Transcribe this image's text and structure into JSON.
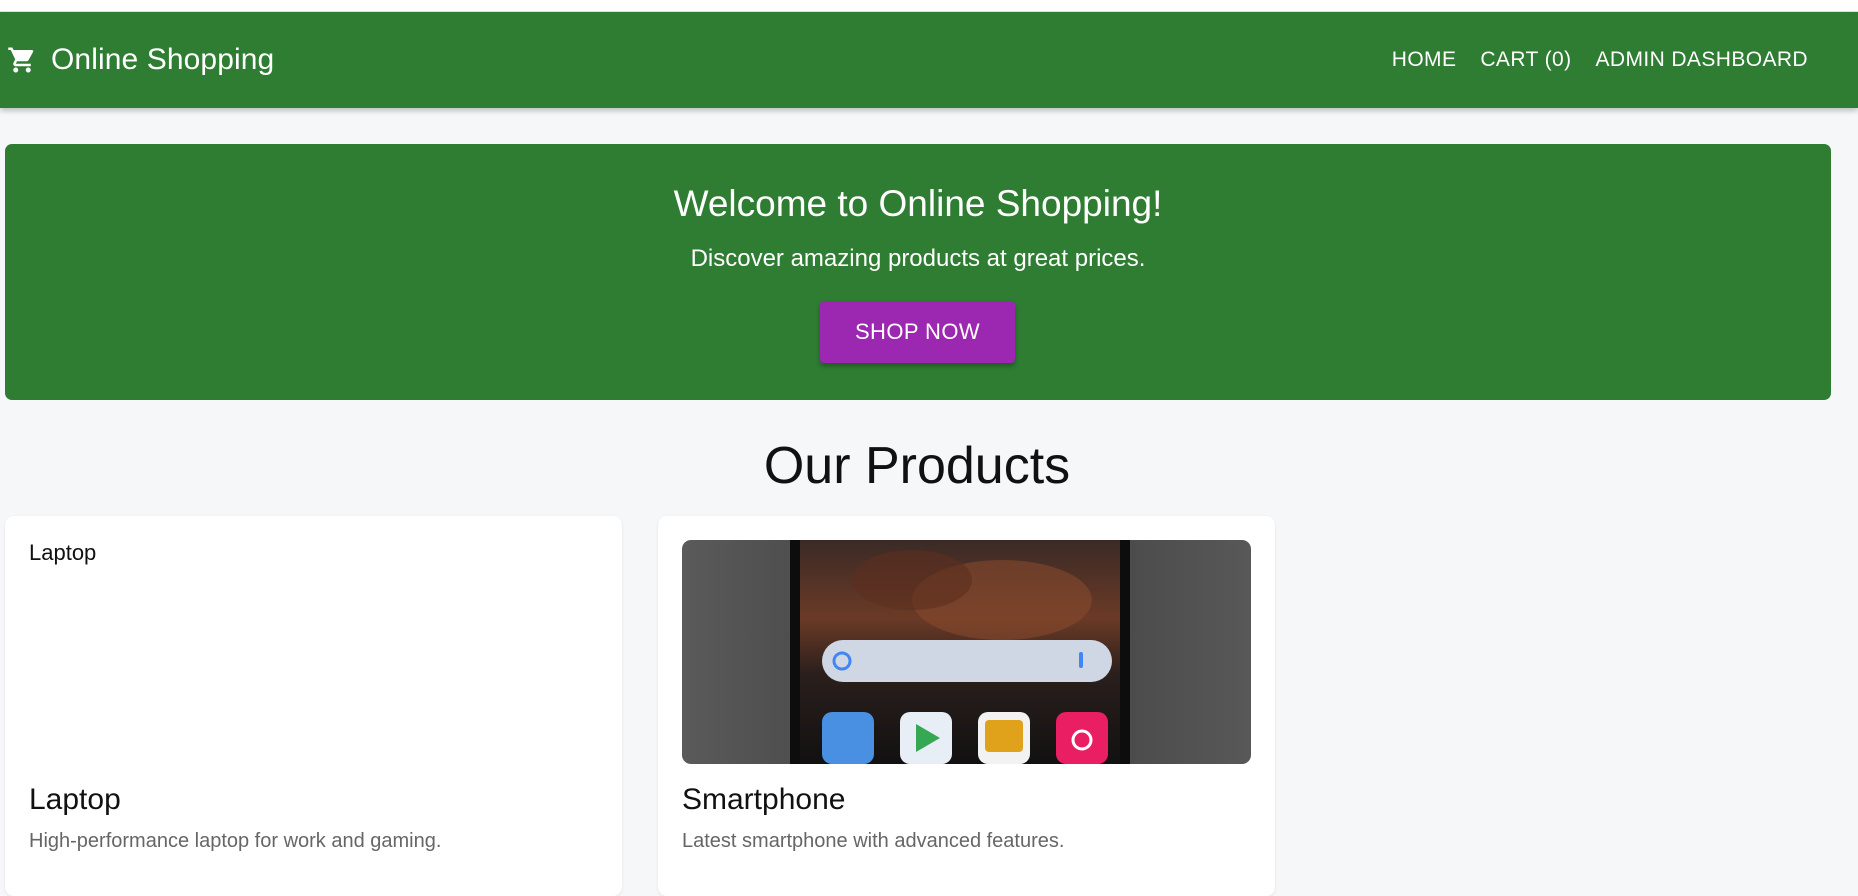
{
  "app_bar": {
    "brand_icon": "shopping-cart-icon",
    "title": "Online Shopping",
    "nav": [
      "HOME",
      "CART (0)",
      "ADMIN DASHBOARD"
    ]
  },
  "hero": {
    "title": "Welcome to Online Shopping!",
    "subtitle": "Discover amazing products at great prices.",
    "cta": "SHOP NOW"
  },
  "products_section": {
    "title": "Our Products",
    "items": [
      {
        "name": "Laptop",
        "description": "High-performance laptop for work and gaming.",
        "image_alt": "Laptop",
        "image_state": "broken"
      },
      {
        "name": "Smartphone",
        "description": "Latest smartphone with advanced features.",
        "image_alt": "Smartphone",
        "image_state": "loaded"
      }
    ]
  },
  "colors": {
    "primary": "#2e7d32",
    "secondary": "#9c27b0",
    "background": "#f6f7f9",
    "card": "#ffffff",
    "muted_text": "#666666"
  }
}
